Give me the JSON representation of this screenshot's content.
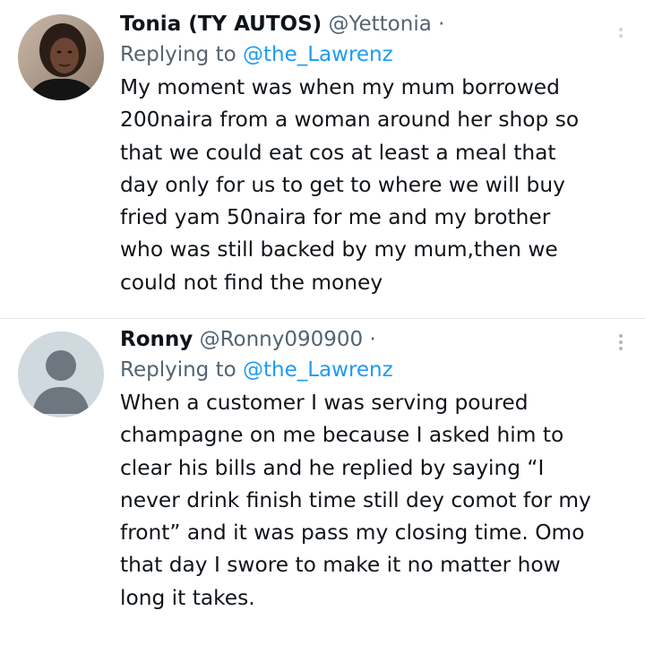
{
  "tweets": [
    {
      "display_name": "Tonia (TY AUTOS)",
      "handle": "@Yettonia",
      "separator": "·",
      "reply_prefix": "Replying to",
      "reply_to": "@the_Lawrenz",
      "body_lines": [
        "My moment was when my mum borrowed",
        "200naira from a woman around her shop so",
        "that we could eat cos at least a meal that",
        "day only for us to get to where we will buy",
        "fried yam 50naira for me and my brother",
        "who was still backed by my mum,then we",
        "could not find the money"
      ]
    },
    {
      "display_name": "Ronny",
      "handle": "@Ronny090900",
      "separator": "·",
      "reply_prefix": "Replying to",
      "reply_to": "@the_Lawrenz",
      "body_lines": [
        "When a customer I was serving poured",
        "champagne on me because I asked him to",
        "clear his bills and he replied by saying “I",
        "never drink finish time still dey comot for my",
        "front” and it was pass my closing time. Omo",
        "that day I swore to make it no matter how",
        "long it takes."
      ]
    }
  ],
  "icons": {
    "more": "more-options-icon",
    "default_avatar": "default-avatar-icon"
  },
  "colors": {
    "text": "#0f1419",
    "secondary": "#536471",
    "link": "#1d9bf0",
    "avatar_placeholder_bg": "#cfd9de",
    "avatar_placeholder_fg": "#6e7780"
  }
}
